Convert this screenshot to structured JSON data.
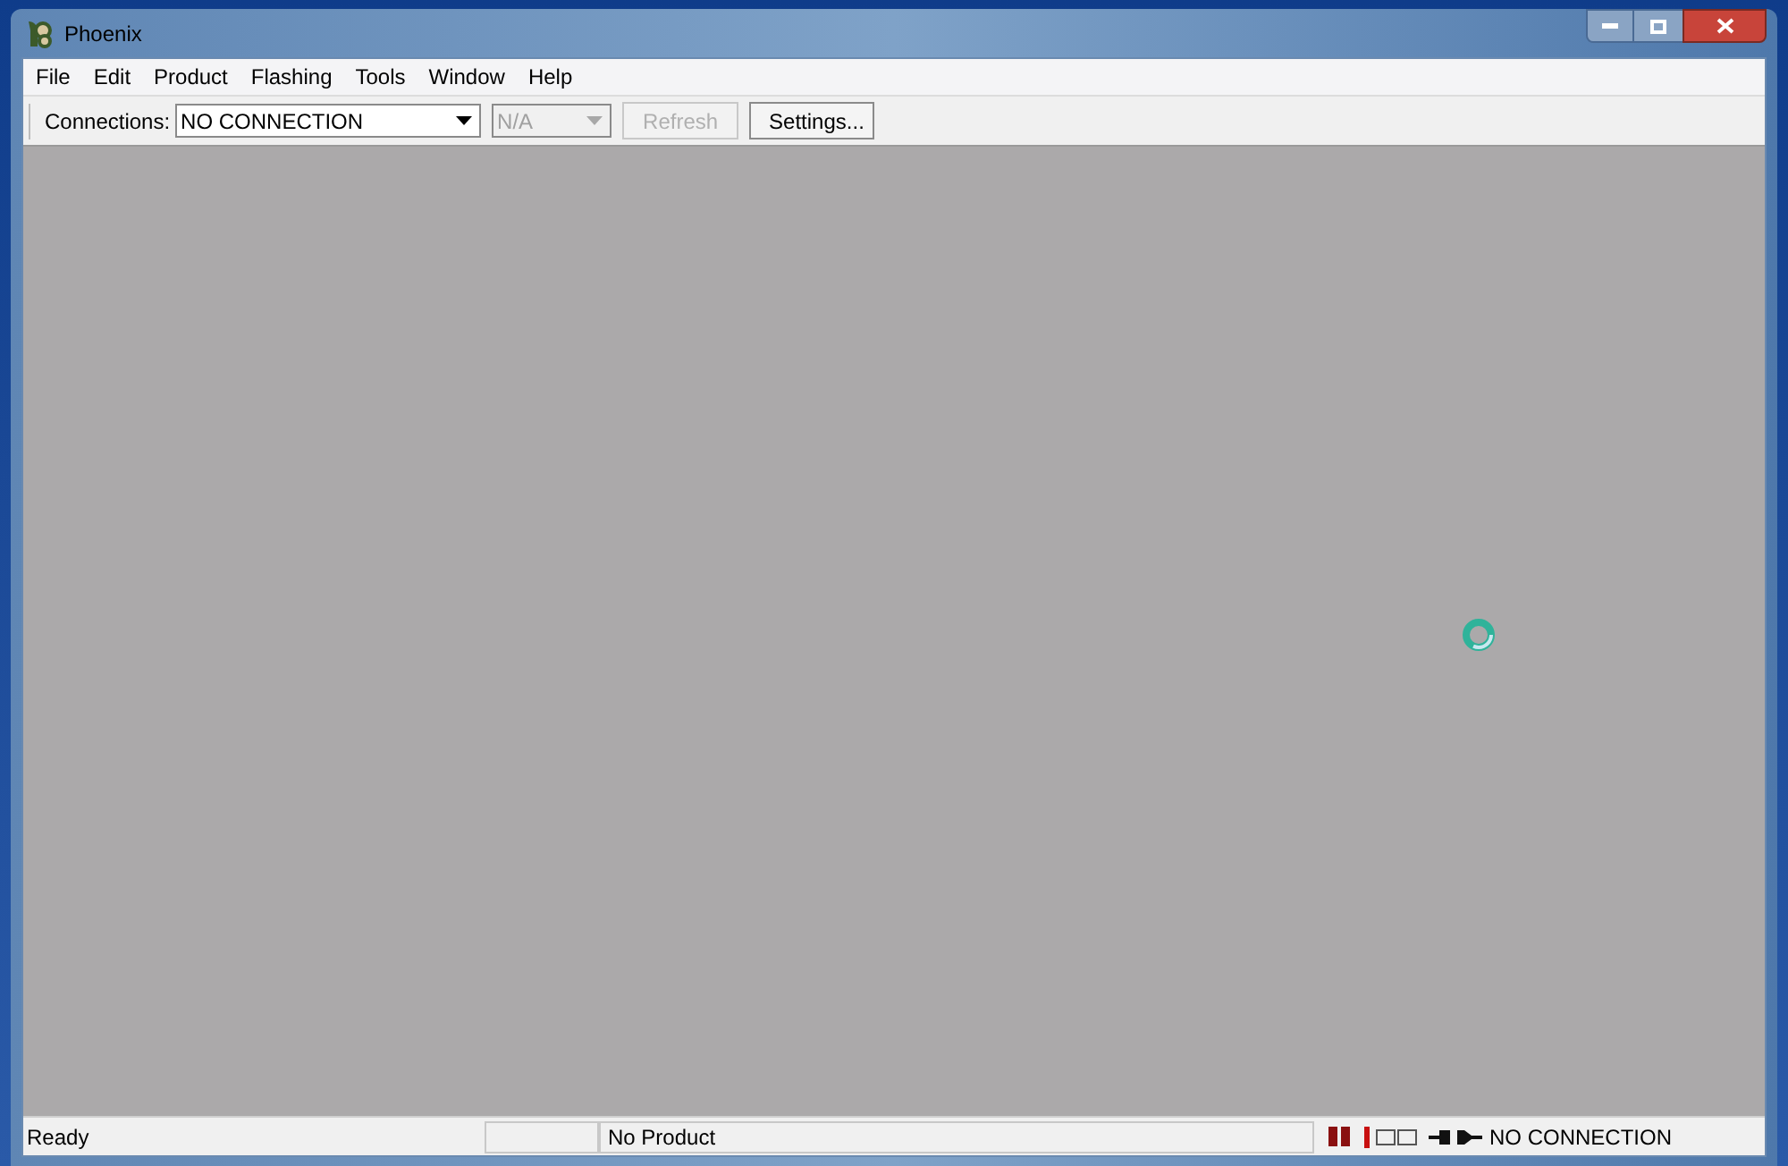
{
  "window": {
    "title": "Phoenix"
  },
  "menu": [
    "File",
    "Edit",
    "Product",
    "Flashing",
    "Tools",
    "Window",
    "Help"
  ],
  "toolbar": {
    "connections_label": "Connections:",
    "controls": [
      {
        "kind": "dropdown",
        "value": "NO CONNECTION",
        "disabled": false
      },
      {
        "kind": "dropdown",
        "value": "N/A",
        "disabled": true
      },
      {
        "kind": "button",
        "label": "Refresh",
        "disabled": true
      },
      {
        "kind": "button",
        "label": "Settings...",
        "disabled": false
      }
    ]
  },
  "status_bar": {
    "message": "Ready",
    "product": "No Product",
    "connection": "NO CONNECTION"
  }
}
